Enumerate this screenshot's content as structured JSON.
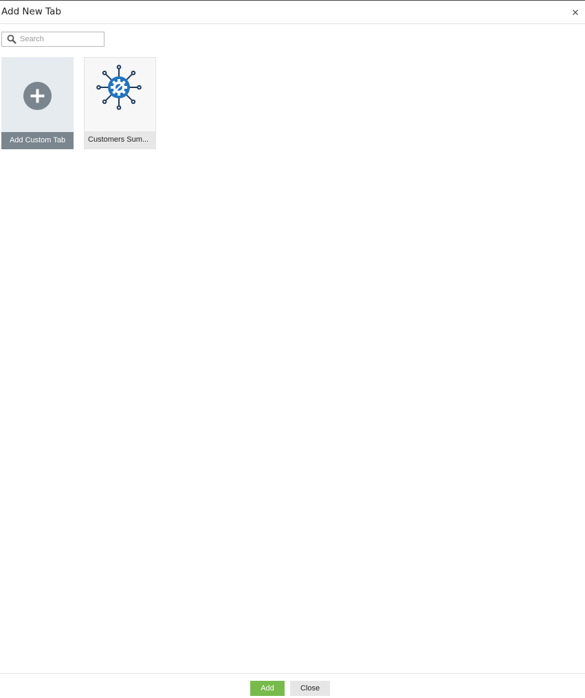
{
  "dialog": {
    "title": "Add New Tab",
    "close_icon": "close-icon"
  },
  "search": {
    "placeholder": "Search",
    "value": "",
    "icon": "search-icon"
  },
  "tiles": [
    {
      "label": "Add Custom Tab",
      "icon": "plus-circle-icon"
    },
    {
      "label": "Customers Sum...",
      "icon": "gear-network-icon"
    }
  ],
  "footer": {
    "add_label": "Add",
    "close_label": "Close"
  },
  "colors": {
    "add_button": "#78bb4c",
    "close_button": "#e6e6e6",
    "custom_tile_bg": "#e5ebee",
    "custom_tile_label_bg": "#7a858d",
    "gear_blue": "#1f74c2",
    "gear_dark": "#1f3a5f"
  }
}
